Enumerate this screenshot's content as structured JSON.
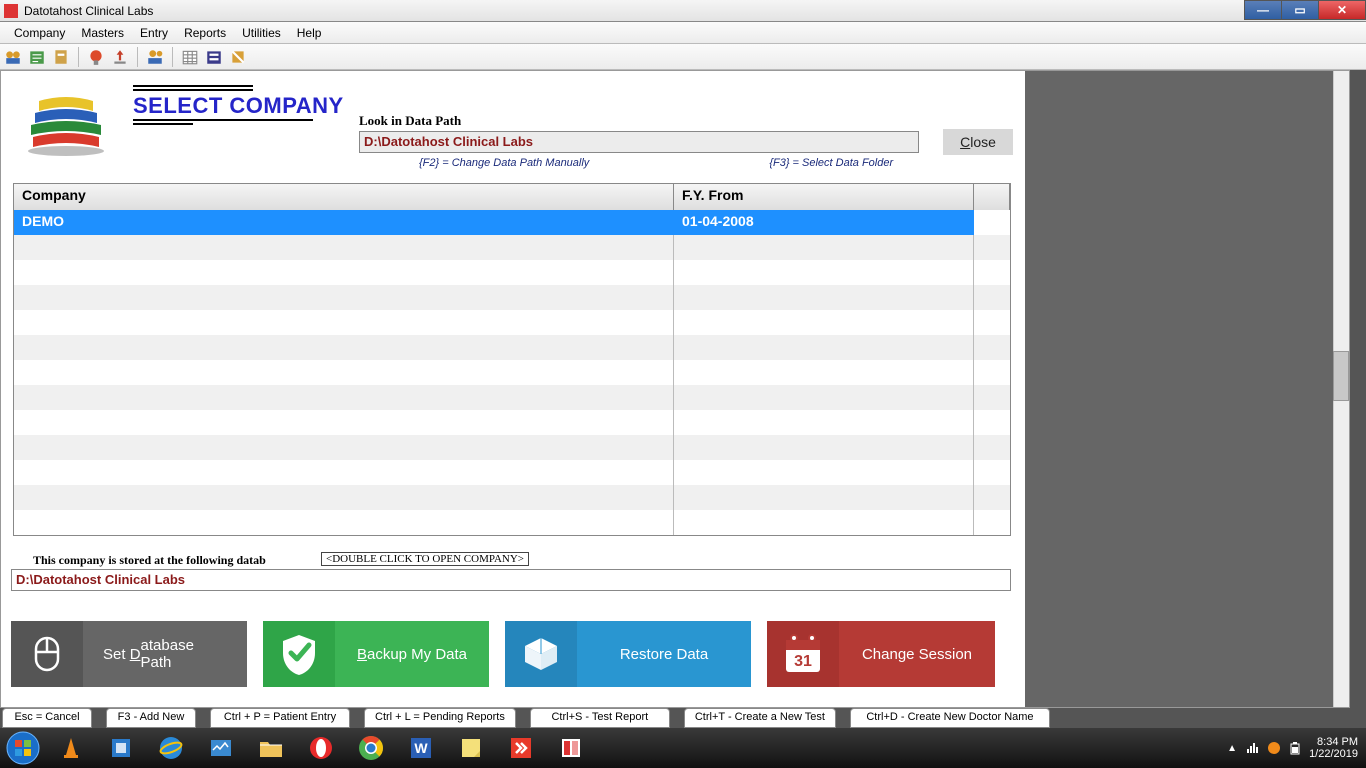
{
  "window": {
    "title": "Datotahost Clinical Labs"
  },
  "menus": [
    "Company",
    "Masters",
    "Entry",
    "Reports",
    "Utilities",
    "Help"
  ],
  "header": {
    "title": "SELECT COMPANY",
    "lookin_label": "Look in Data Path",
    "data_path": "D:\\Datotahost Clinical Labs",
    "hint_f2": "{F2} = Change Data Path Manually",
    "hint_f3": "{F3} = Select Data Folder",
    "close_label": "Close"
  },
  "table": {
    "col_company": "Company",
    "col_fy": "F.Y.  From",
    "rows": [
      {
        "company": "DEMO",
        "fy": "01-04-2008"
      }
    ]
  },
  "under": {
    "stored_at_label": "This company is stored at the following datab",
    "dbl_click": "<DOUBLE CLICK TO OPEN COMPANY>",
    "stored_path": "D:\\Datotahost Clinical Labs"
  },
  "bigbuttons": {
    "db_path": "Set Database Path",
    "db_path_pre": "Set ",
    "db_path_u": "D",
    "db_path_post": "atabase Path",
    "backup": "Backup My Data",
    "backup_u": "B",
    "backup_post": "ackup My Data",
    "restore": "Restore Data",
    "session": "Change Session"
  },
  "shortcuts": [
    "Esc = Cancel",
    "F3 - Add New",
    "Ctrl + P = Patient Entry",
    "Ctrl + L = Pending Reports",
    "Ctrl+S - Test Report",
    "Ctrl+T -  Create a New Test",
    "Ctrl+D - Create New Doctor Name"
  ],
  "tray": {
    "time": "8:34 PM",
    "date": "1/22/2019"
  }
}
